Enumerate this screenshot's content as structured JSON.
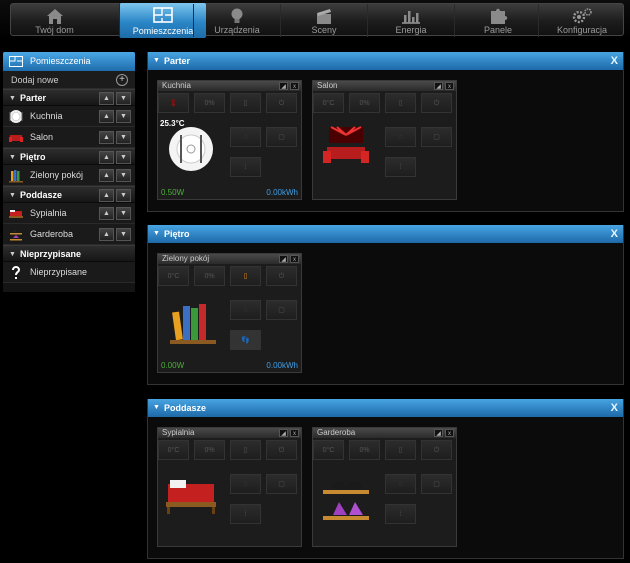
{
  "nav": {
    "items": [
      {
        "label": "Twój dom",
        "icon": "house-icon"
      },
      {
        "label": "Pomieszczenia",
        "icon": "rooms-icon"
      },
      {
        "label": "Urządzenia",
        "icon": "bulb-icon"
      },
      {
        "label": "Sceny",
        "icon": "clapper-icon"
      },
      {
        "label": "Energia",
        "icon": "energy-chart-icon"
      },
      {
        "label": "Panele",
        "icon": "puzzle-icon"
      },
      {
        "label": "Konfiguracja",
        "icon": "gears-icon"
      }
    ],
    "active_index": 1
  },
  "sidebar": {
    "title": "Pomieszczenia",
    "add_label": "Dodaj nowe",
    "groups": [
      {
        "label": "Parter",
        "rooms": [
          "Kuchnia",
          "Salon"
        ]
      },
      {
        "label": "Piętro",
        "rooms": [
          "Zielony pokój"
        ]
      },
      {
        "label": "Poddasze",
        "rooms": [
          "Sypialnia",
          "Garderoba"
        ]
      },
      {
        "label": "Nieprzypisane",
        "rooms": [
          "Nieprzypisane"
        ]
      }
    ]
  },
  "panels": [
    {
      "title": "Parter",
      "close": "X",
      "rooms": [
        {
          "name": "Kuchnia",
          "temp_label": "0°C",
          "humidity_label": "0%",
          "temperature": "25.3°C",
          "power": "0.50W",
          "energy": "0.00kWh"
        },
        {
          "name": "Salon",
          "temp_label": "0°C",
          "humidity_label": "0%"
        }
      ]
    },
    {
      "title": "Piętro",
      "close": "X",
      "rooms": [
        {
          "name": "Zielony pokój",
          "temp_label": "0°C",
          "humidity_label": "0%",
          "power": "0.00W",
          "energy": "0.00kWh"
        }
      ]
    },
    {
      "title": "Poddasze",
      "close": "X",
      "rooms": [
        {
          "name": "Sypialnia",
          "temp_label": "0°C",
          "humidity_label": "0%"
        },
        {
          "name": "Garderoba",
          "temp_label": "0°C",
          "humidity_label": "0%"
        }
      ]
    }
  ],
  "card_buttons": {
    "pin": "◢",
    "close": "x"
  },
  "colors": {
    "accent": "#2a86c6",
    "power": "#4caf3a",
    "energy": "#3f9ee6",
    "alarm": "#cc0000"
  }
}
